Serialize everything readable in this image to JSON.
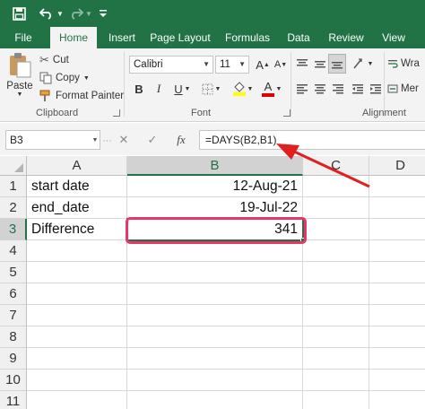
{
  "quick_access": {
    "save_icon": "save-icon",
    "undo_icon": "undo-icon",
    "redo_icon": "redo-icon",
    "customize_icon": "customize-qat-icon"
  },
  "tabs": [
    {
      "label": "File"
    },
    {
      "label": "Home",
      "active": true
    },
    {
      "label": "Insert"
    },
    {
      "label": "Page Layout"
    },
    {
      "label": "Formulas"
    },
    {
      "label": "Data"
    },
    {
      "label": "Review"
    },
    {
      "label": "View"
    }
  ],
  "ribbon": {
    "clipboard": {
      "paste_label": "Paste",
      "cut_label": "Cut",
      "copy_label": "Copy",
      "format_painter_label": "Format Painter",
      "group_label": "Clipboard"
    },
    "font": {
      "font_name": "Calibri",
      "font_size": "11",
      "bold": "B",
      "italic": "I",
      "underline": "U",
      "group_label": "Font"
    },
    "alignment": {
      "wrap_label": "Wra",
      "merge_label": "Mer",
      "group_label": "Alignment"
    }
  },
  "formula_bar": {
    "name_box": "B3",
    "cancel_glyph": "✕",
    "enter_glyph": "✓",
    "fx_glyph": "fx",
    "formula": "=DAYS(B2,B1)"
  },
  "grid": {
    "columns": [
      "A",
      "B",
      "C",
      "D"
    ],
    "rows": [
      "1",
      "2",
      "3",
      "4",
      "5",
      "6",
      "7",
      "8",
      "9",
      "10",
      "11"
    ],
    "cells": {
      "A1": "start date",
      "B1": "12-Aug-21",
      "A2": "end_date",
      "B2": "19-Jul-22",
      "A3": "Difference",
      "B3": "341"
    }
  },
  "colors": {
    "excel_green": "#217346",
    "annotation_pink": "#e8356a",
    "arrow_red": "#e02020"
  }
}
